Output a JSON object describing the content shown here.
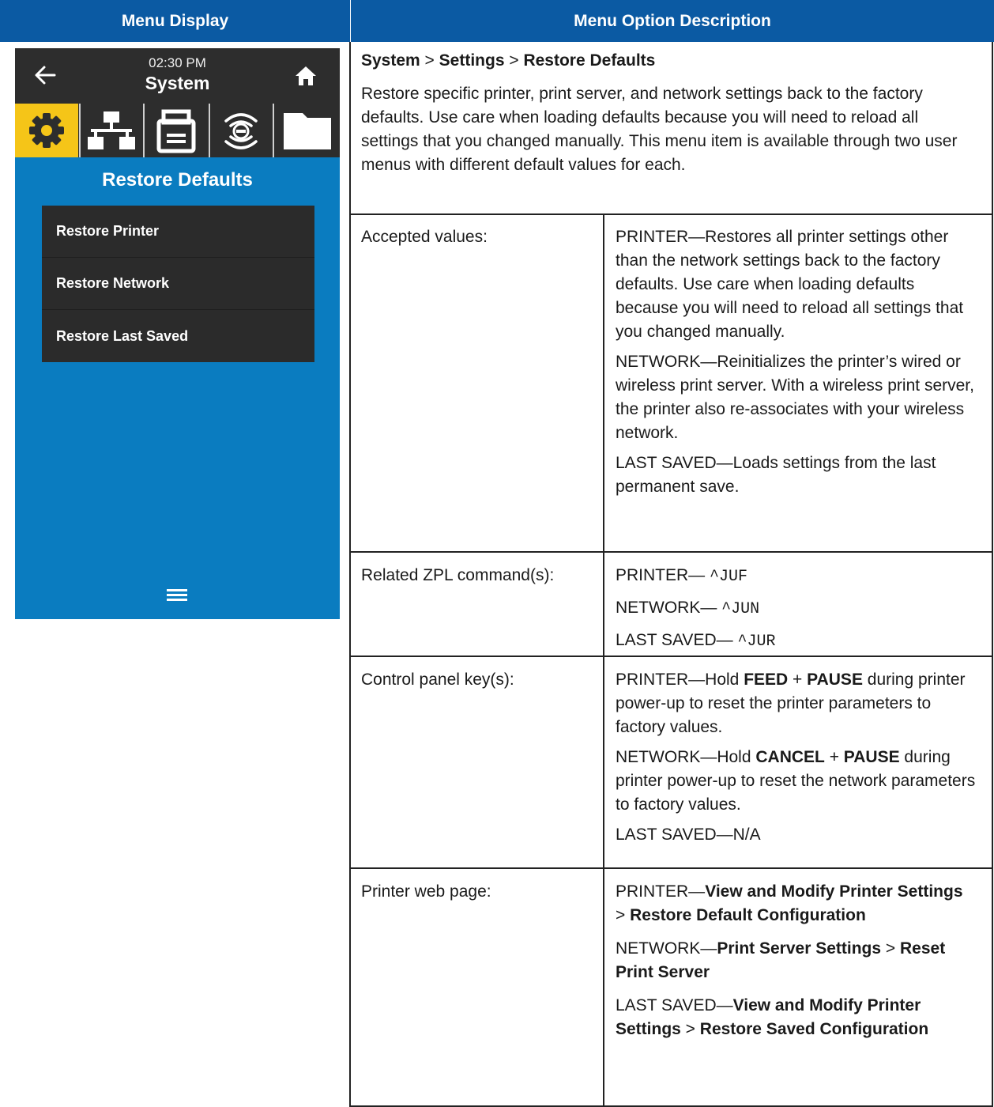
{
  "headers": {
    "left": "Menu Display",
    "right": "Menu Option Description"
  },
  "device": {
    "time": "02:30 PM",
    "title": "System",
    "icons": [
      "back-arrow-icon",
      "home-icon",
      "gear-icon",
      "network-icon",
      "printer-icon",
      "wireless-icon",
      "folder-icon",
      "hamburger-menu-icon"
    ],
    "screen_title": "Restore Defaults",
    "menu_items": [
      "Restore Printer",
      "Restore Network",
      "Restore Last Saved"
    ],
    "colors": {
      "screen_blue": "#0a7cc0",
      "top_bar": "#2d2d2d",
      "selected_tab": "#f5c518"
    }
  },
  "path": {
    "a": "System",
    "sep1": " > ",
    "b": "Settings",
    "sep2": " > ",
    "c": "Restore Defaults"
  },
  "intro": "Restore specific printer, print server, and network settings back to the factory defaults. Use care when loading defaults because you will need to reload all settings that you changed manually. This menu item is available through two user menus with different default values for each.",
  "rows": {
    "accepted": {
      "label": "Accepted values:",
      "p1": "PRINTER—Restores all printer settings other than the network settings back to the factory defaults. Use care when loading defaults because you will need to reload all settings that you changed manually.",
      "p2": "NETWORK—Reinitializes the printer’s wired or wireless print server. With a wireless print server, the printer also re-associates with your wireless network.",
      "p3": "LAST SAVED—Loads settings from the last permanent save."
    },
    "zpl": {
      "label": "Related ZPL command(s):",
      "p1_pre": "PRINTER— ",
      "p1_code": "^JUF",
      "p2_pre": "NETWORK— ",
      "p2_code": "^JUN",
      "p3_pre": "LAST SAVED— ",
      "p3_code": "^JUR"
    },
    "keys": {
      "label": "Control panel key(s):",
      "p1_a": "PRINTER—Hold ",
      "p1_b": "FEED",
      "p1_c": " + ",
      "p1_d": "PAUSE",
      "p1_e": " during printer power-up to reset the printer parameters to factory values.",
      "p2_a": "NETWORK—Hold ",
      "p2_b": "CANCEL",
      "p2_c": " + ",
      "p2_d": "PAUSE",
      "p2_e": " during printer power-up to reset the network parameters to factory values.",
      "p3": "LAST SAVED—N/A"
    },
    "web": {
      "label": "Printer web page:",
      "p1_a": "PRINTER—",
      "p1_b": "View and Modify Printer Settings",
      "p1_c": " > ",
      "p1_d": "Restore Default Configuration",
      "p2_a": "NETWORK—",
      "p2_b": "Print Server Settings",
      "p2_c": " > ",
      "p2_d": "Reset Print Server",
      "p3_a": "LAST SAVED—",
      "p3_b": "View and Modify Printer Settings",
      "p3_c": " > ",
      "p3_d": "Restore Saved Configuration"
    }
  }
}
